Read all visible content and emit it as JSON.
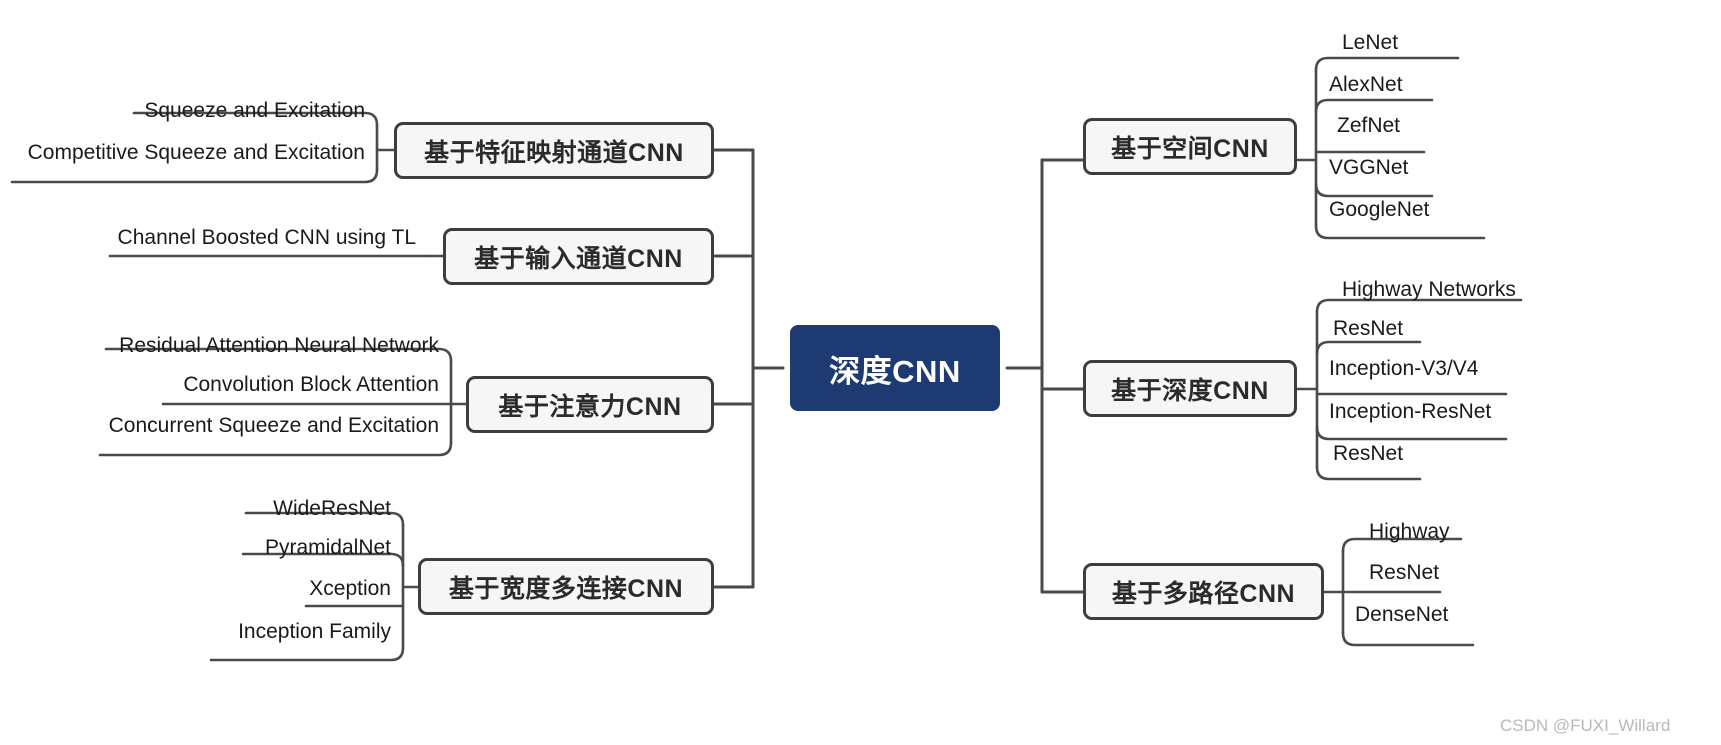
{
  "diagram": {
    "title": "深度CNN 分类思维导图",
    "root": {
      "label": "深度CNN"
    },
    "colors": {
      "root_fill": "#1e3a72",
      "root_text": "#ffffff",
      "branch_fill": "#f6f6f6",
      "branch_border": "#3d3d3d",
      "branch_text": "#2b2b2b",
      "connector": "#4a4a4a",
      "leaf_text": "#1a1a1a",
      "watermark": "#b9b9b9"
    },
    "left_branches": [
      {
        "label": "基于特征映射通道CNN",
        "leaves": [
          "Squeeze and Excitation",
          "Competitive Squeeze and Excitation"
        ]
      },
      {
        "label": "基于输入通道CNN",
        "leaves": [
          "Channel Boosted CNN using TL"
        ]
      },
      {
        "label": "基于注意力CNN",
        "leaves": [
          "Residual Attention Neural Network",
          "Convolution Block Attention",
          "Concurrent Squeeze and Excitation"
        ]
      },
      {
        "label": "基于宽度多连接CNN",
        "leaves": [
          "WideResNet",
          "PyramidalNet",
          "Xception",
          "Inception Family"
        ]
      }
    ],
    "right_branches": [
      {
        "label": "基于空间CNN",
        "leaves": [
          "LeNet",
          "AlexNet",
          "ZefNet",
          "VGGNet",
          "GoogleNet"
        ]
      },
      {
        "label": "基于深度CNN",
        "leaves": [
          "Highway Networks",
          "ResNet",
          "Inception-V3/V4",
          "Inception-ResNet",
          "ResNet"
        ]
      },
      {
        "label": "基于多路径CNN",
        "leaves": [
          "Highway",
          "ResNet",
          "DenseNet"
        ]
      }
    ],
    "watermark": "CSDN @FUXI_Willard"
  }
}
